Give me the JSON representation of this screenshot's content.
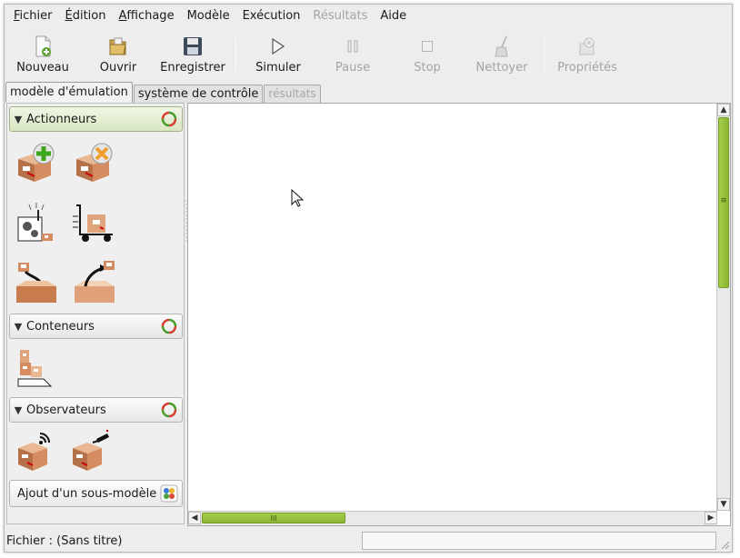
{
  "menubar": {
    "items": [
      {
        "label": "Fichier",
        "mnemonic": "F"
      },
      {
        "label": "Édition",
        "mnemonic": "É"
      },
      {
        "label": "Affichage",
        "mnemonic": "A"
      },
      {
        "label": "Modèle",
        "mnemonic": ""
      },
      {
        "label": "Exécution",
        "mnemonic": ""
      },
      {
        "label": "Résultats",
        "mnemonic": "",
        "disabled": true
      },
      {
        "label": "Aide",
        "mnemonic": ""
      }
    ]
  },
  "toolbar": {
    "new_label": "Nouveau",
    "open_label": "Ouvrir",
    "save_label": "Enregistrer",
    "simulate_label": "Simuler",
    "pause_label": "Pause",
    "stop_label": "Stop",
    "clean_label": "Nettoyer",
    "properties_label": "Propriétés"
  },
  "tabs": {
    "emulation_label": "modèle d'émulation",
    "control_label": "système de contrôle",
    "results_label": "résultats"
  },
  "palette": {
    "actuators_title": "Actionneurs",
    "containers_title": "Conteneurs",
    "observers_title": "Observateurs",
    "submodel_label": "Ajout d'un sous-modèle",
    "icons": [
      "box-create-icon",
      "box-destroy-icon",
      "machine-icon",
      "cart-icon",
      "drop-in-box-icon",
      "take-out-box-icon",
      "stack-icon",
      "box-sensor-icon",
      "box-scanner-icon"
    ]
  },
  "canvas": {
    "hscroll_grip": "III",
    "vscroll_grip": "≡"
  },
  "statusbar": {
    "text": "Fichier : (Sans titre)"
  },
  "colors": {
    "accent": "#8ab631",
    "window_bg": "#ededed"
  }
}
